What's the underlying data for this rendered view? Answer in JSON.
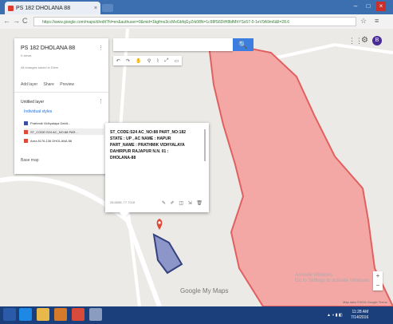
{
  "browser": {
    "tab_title": "PS 182 DHOLANA 88",
    "tab_close": "×",
    "url": "https://www.google.com/maps/d/edit?hl=en&authuser=0&mid=1kgfmo3ccMxGbfqGyZrk08N=1c98fS6DtH8bfMhYSx57-0-1eV9A9m6&ll=28.6",
    "nav_back": "←",
    "nav_forward": "→",
    "nav_reload": "C",
    "window_min": "–",
    "window_max": "□",
    "window_close": "×"
  },
  "panel": {
    "title": "PS 182 DHOLANA 88",
    "subtitle": "0 views",
    "description": "All changes saved in Drive",
    "actions": [
      "Add layer",
      "Share",
      "Preview"
    ],
    "layer_name": "Untitled layer",
    "layer_style": "Individual styles",
    "items": [
      {
        "label": "Prathmik Vidhyalaya Dahit...",
        "color": "#3a4fa0"
      },
      {
        "label": "ST_CODE:S24 AC_NO:88 PAR...",
        "color": "#e04a3a"
      },
      {
        "label": "Area 8176.136 DHOLANA 88",
        "color": "#e04a3a"
      }
    ],
    "base_map": "Base map",
    "menu_glyph": "⋮"
  },
  "toolbar": {
    "search_placeholder": "",
    "search_button": "🔍",
    "tools": [
      "↶",
      "↷",
      "✋",
      "⚲",
      "⌇",
      "⤢",
      "▭"
    ]
  },
  "topright": {
    "apps_icon": "⋮⋮",
    "gear_icon": "⚙",
    "avatar_letter": "B"
  },
  "popup": {
    "text": "ST_CODE:S24 AC_NO:88 PART_NO:182\nSTATE : UP , AC NAME : HAPUR\nPART_NAME : PRATHMIK VIDHYALAYA\nDAHIRPUR RAJAPUR N.N. 01 :\nDHOLANA-88",
    "coord": "28.6658, 77.7018",
    "actions": "✎ ✐ ◫ ⇲ 🗑"
  },
  "map": {
    "google_logo": "Google My Maps",
    "terms": "Map data ©2016 Google  Terms",
    "watermark": "Activate Windows\nGo to Settings to activate Windows.",
    "zoom_in": "+",
    "zoom_out": "−",
    "polygon_fill": "#f3a8a6",
    "polygon_stroke": "#e06060",
    "small_polygon_fill": "#8d96c8",
    "small_polygon_stroke": "#33417f",
    "pin_color": "#e04a3a"
  },
  "taskbar": {
    "clock_time": "11:28 AM",
    "clock_date": "7/14/2016",
    "tray": "▲ ◖ ▮ ◧"
  }
}
